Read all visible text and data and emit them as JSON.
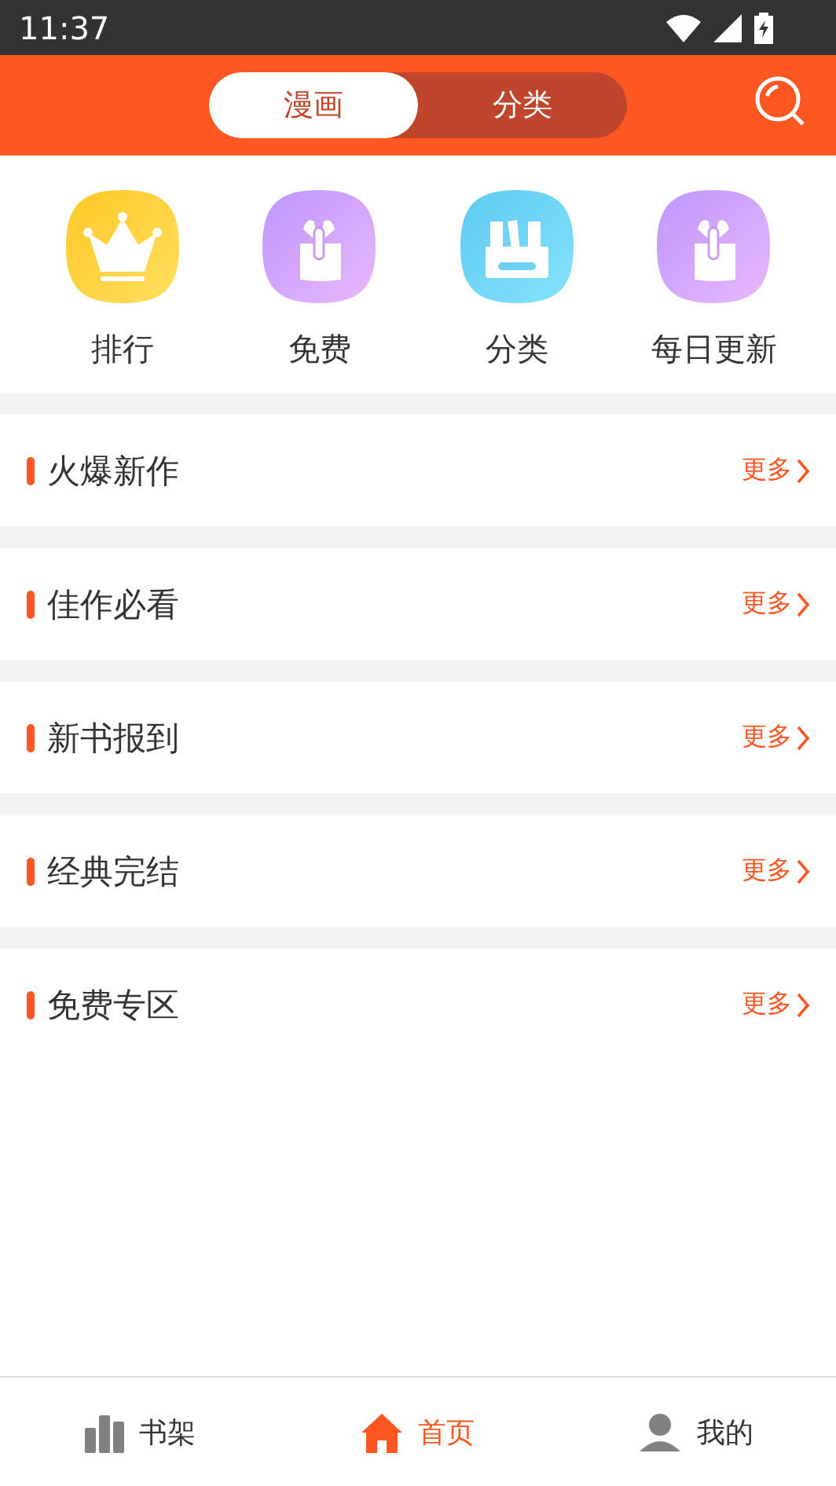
{
  "status_bar": {
    "time": "11:37"
  },
  "header": {
    "tabs": [
      {
        "label": "漫画",
        "selected": true
      },
      {
        "label": "分类",
        "selected": false
      }
    ]
  },
  "shortcuts": [
    {
      "label": "排行"
    },
    {
      "label": "免费"
    },
    {
      "label": "分类"
    },
    {
      "label": "每日更新"
    }
  ],
  "sections": [
    {
      "title": "火爆新作",
      "more": "更多"
    },
    {
      "title": "佳作必看",
      "more": "更多"
    },
    {
      "title": "新书报到",
      "more": "更多"
    },
    {
      "title": "经典完结",
      "more": "更多"
    },
    {
      "title": "免费专区",
      "more": "更多"
    }
  ],
  "bottom_nav": [
    {
      "label": "书架",
      "selected": false
    },
    {
      "label": "首页",
      "selected": true
    },
    {
      "label": "我的",
      "selected": false
    }
  ]
}
